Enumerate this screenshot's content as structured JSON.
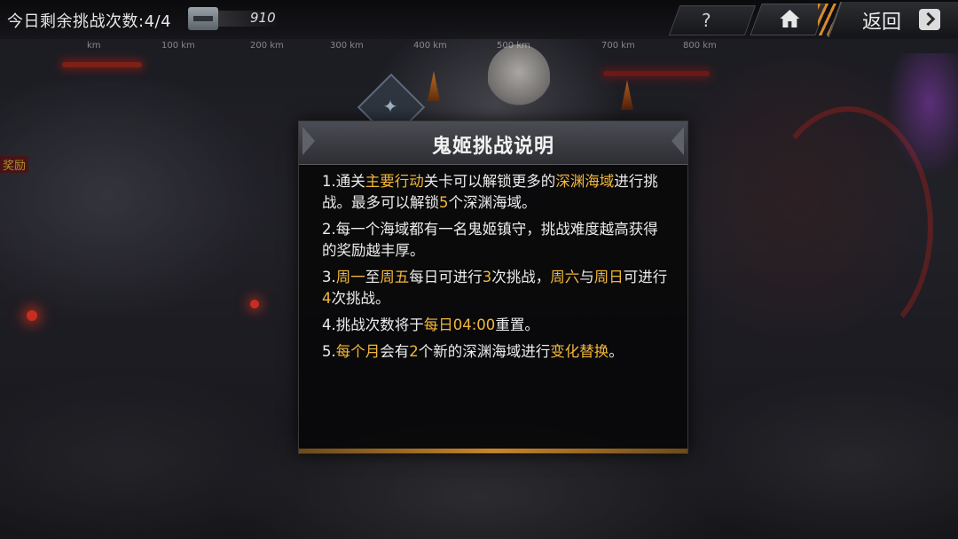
{
  "hud": {
    "challenges_left_label": "今日剩余挑战次数:",
    "challenges_left_value": "4/4",
    "resource_icon": "warship-icon",
    "resource_value": "910",
    "distance_ticks": [
      "km",
      "100 km",
      "200 km",
      "300 km",
      "400 km",
      "500 km",
      "700 km",
      "800 km"
    ],
    "help_label": "?",
    "home_icon": "home-icon",
    "back_label": "返回",
    "back_icon": "chevron-right-icon"
  },
  "map": {
    "left_label": "奖励"
  },
  "dialog": {
    "title": "鬼姬挑战说明",
    "rules": [
      [
        {
          "t": "1.通关"
        },
        {
          "t": "主要行动",
          "hl": true
        },
        {
          "t": "关卡可以解锁更多的"
        },
        {
          "t": "深渊海域",
          "hl": true
        },
        {
          "t": "进行挑战。最多可以解锁"
        },
        {
          "t": "5",
          "hl": true
        },
        {
          "t": "个深渊海域。"
        }
      ],
      [
        {
          "t": "2.每一个海域都有一名鬼姬镇守，挑战难度越高获得的奖励越丰厚。"
        }
      ],
      [
        {
          "t": "3."
        },
        {
          "t": "周一",
          "hl": true
        },
        {
          "t": "至"
        },
        {
          "t": "周五",
          "hl": true
        },
        {
          "t": "每日可进行"
        },
        {
          "t": "3",
          "hl": true
        },
        {
          "t": "次挑战，"
        },
        {
          "t": "周六",
          "hl": true
        },
        {
          "t": "与"
        },
        {
          "t": "周日",
          "hl": true
        },
        {
          "t": "可进行"
        },
        {
          "t": "4",
          "hl": true
        },
        {
          "t": "次挑战。"
        }
      ],
      [
        {
          "t": "4.挑战次数将于"
        },
        {
          "t": "每日04:00",
          "hl": true
        },
        {
          "t": "重置。"
        }
      ],
      [
        {
          "t": "5."
        },
        {
          "t": "每个月",
          "hl": true
        },
        {
          "t": "会有"
        },
        {
          "t": "2",
          "hl": true
        },
        {
          "t": "个新的深渊海域进行"
        },
        {
          "t": "变化替换",
          "hl": true
        },
        {
          "t": "。"
        }
      ]
    ]
  },
  "colors": {
    "highlight": "#f2b73a",
    "accent_orange": "#d98a2a"
  }
}
